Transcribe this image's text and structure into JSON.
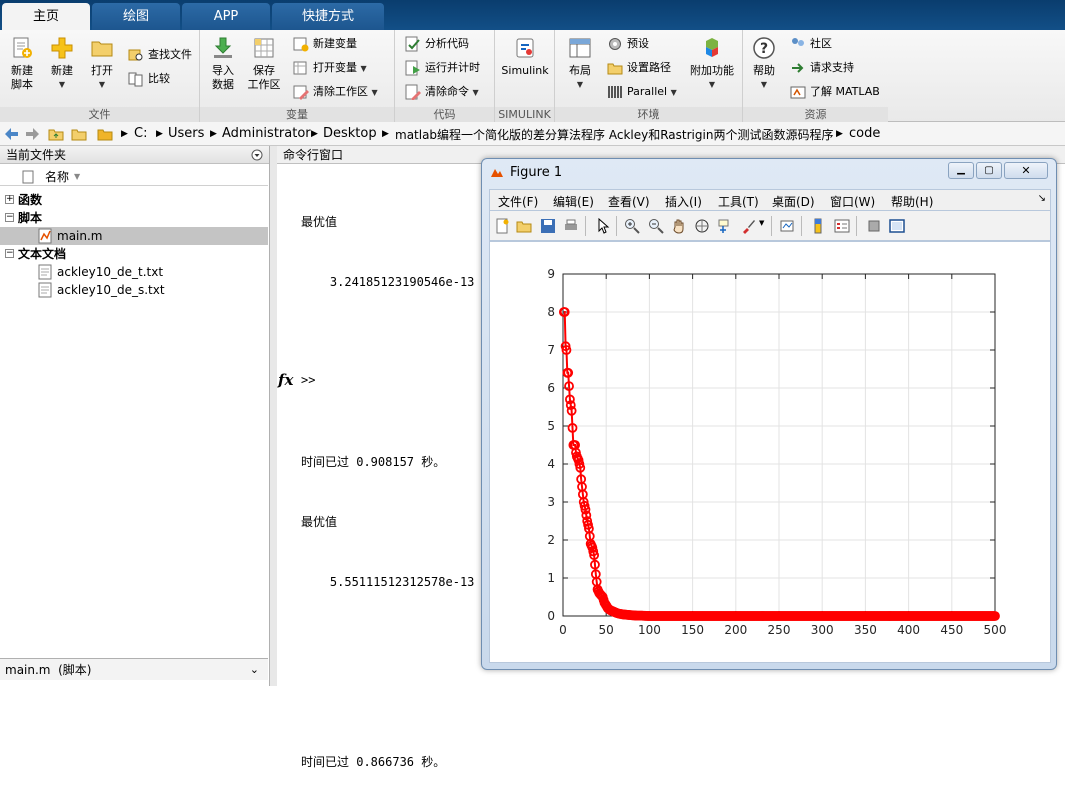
{
  "tabs": [
    "主页",
    "绘图",
    "APP",
    "快捷方式"
  ],
  "ribbon": {
    "file_group": {
      "label": "文件",
      "new_script": "新建\n脚本",
      "new": "新建",
      "open": "打开",
      "find_files": "查找文件",
      "compare": "比较"
    },
    "var_group": {
      "label": "变量",
      "import": "导入\n数据",
      "save_ws": "保存\n工作区",
      "new_var": "新建变量",
      "open_var": "打开变量",
      "clear_ws": "清除工作区"
    },
    "code_group": {
      "label": "代码",
      "analyze": "分析代码",
      "run_time": "运行并计时",
      "clear_cmd": "清除命令"
    },
    "simulink_group": {
      "label": "SIMULINK",
      "simulink": "Simulink"
    },
    "env_group": {
      "label": "环境",
      "layout": "布局",
      "prefs": "预设",
      "set_path": "设置路径",
      "parallel": "Parallel",
      "addons": "附加功能"
    },
    "res_group": {
      "label": "资源",
      "help": "帮助",
      "community": "社区",
      "support": "请求支持",
      "learn": "了解 MATLAB"
    }
  },
  "address": [
    "C:",
    "Users",
    "Administrator",
    "Desktop",
    "matlab编程一个简化版的差分算法程序 Ackley和Rastrigin两个测试函数源码程序",
    "code"
  ],
  "current_folder": {
    "title": "当前文件夹",
    "col_name": "名称",
    "groups": [
      {
        "name": "函数",
        "items": []
      },
      {
        "name": "脚本",
        "items": [
          "main.m"
        ]
      },
      {
        "name": "文本文档",
        "items": [
          "ackley10_de_t.txt",
          "ackley10_de_s.txt"
        ]
      }
    ],
    "status": "main.m  (脚本)"
  },
  "command_window": {
    "title": "命令行窗口",
    "lines": [
      "最优值",
      "    3.24185123190546e-13",
      "",
      "",
      "时间已过 0.908157 秒。",
      "最优值",
      "    5.55111512312578e-13",
      "",
      "",
      "时间已过 0.866736 秒。"
    ],
    "prompt": ">>",
    "fx": "fx"
  },
  "figure": {
    "title": "Figure 1",
    "menu": [
      "文件(F)",
      "编辑(E)",
      "查看(V)",
      "插入(I)",
      "工具(T)",
      "桌面(D)",
      "窗口(W)",
      "帮助(H)"
    ]
  },
  "chart_data": {
    "type": "line",
    "title": "",
    "xlabel": "",
    "ylabel": "",
    "xlim": [
      0,
      500
    ],
    "ylim": [
      0,
      9
    ],
    "xticks": [
      0,
      50,
      100,
      150,
      200,
      250,
      300,
      350,
      400,
      450,
      500
    ],
    "yticks": [
      0,
      1,
      2,
      3,
      4,
      5,
      6,
      7,
      8,
      9
    ],
    "grid": true,
    "marker": "circle",
    "color": "#ff0000",
    "series": [
      {
        "x": [
          1,
          2,
          3,
          4,
          5,
          6,
          8,
          10,
          12,
          14,
          15,
          16,
          18,
          20,
          21,
          22,
          23,
          24,
          25,
          26,
          28,
          30,
          32,
          34,
          35,
          36,
          38,
          40,
          42,
          44,
          46,
          48,
          50,
          52,
          55,
          58,
          60,
          62,
          65,
          68,
          70,
          75,
          80,
          85,
          90,
          95,
          100,
          110,
          120,
          130,
          150,
          200,
          250,
          300,
          350,
          400,
          450,
          500
        ],
        "y": [
          8.0,
          8.0,
          7.1,
          7.0,
          6.4,
          6.4,
          5.7,
          5.4,
          4.5,
          4.5,
          4.3,
          4.2,
          4.1,
          3.9,
          3.6,
          3.4,
          3.2,
          3.0,
          2.9,
          2.8,
          2.5,
          2.3,
          1.9,
          1.8,
          1.7,
          1.6,
          1.1,
          0.7,
          0.6,
          0.55,
          0.5,
          0.35,
          0.28,
          0.2,
          0.15,
          0.12,
          0.1,
          0.08,
          0.06,
          0.05,
          0.04,
          0.03,
          0.02,
          0.01,
          0.01,
          0.005,
          0,
          0,
          0,
          0,
          0,
          0,
          0,
          0,
          0,
          0,
          0,
          0
        ]
      }
    ]
  }
}
